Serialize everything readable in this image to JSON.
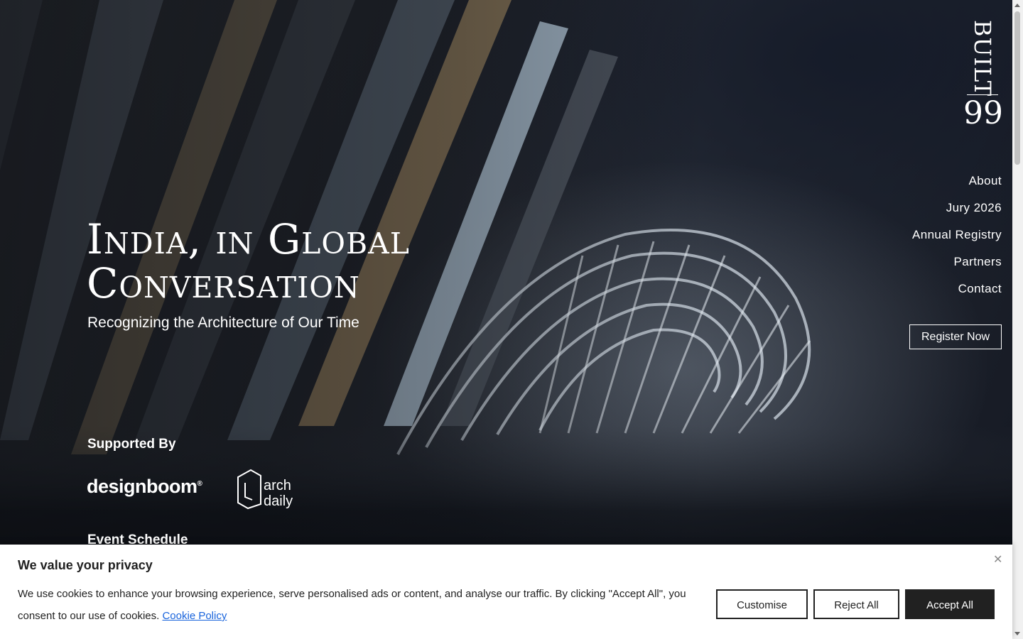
{
  "logo": {
    "word": "BUILT",
    "number": "99"
  },
  "nav": {
    "items": [
      {
        "label": "About"
      },
      {
        "label": "Jury 2026"
      },
      {
        "label": "Annual Registry"
      },
      {
        "label": "Partners"
      },
      {
        "label": "Contact"
      }
    ],
    "register_label": "Register Now"
  },
  "hero": {
    "headline_line1": "India, in Global",
    "headline_line2": "Conversation",
    "subhead": "Recognizing the Architecture of Our Time"
  },
  "supported": {
    "heading": "Supported By",
    "partners": [
      {
        "name": "designboom",
        "mark": "®"
      },
      {
        "line1": "arch",
        "line2": "daily"
      }
    ]
  },
  "schedule": {
    "heading": "Event Schedule"
  },
  "cookie": {
    "title": "We value your privacy",
    "body": "We use cookies to enhance your browsing experience, serve personalised ads or content, and analyse our traffic. By clicking \"Accept All\", you consent to our use of cookies.",
    "link_label": "Cookie Policy",
    "close_icon": "close-icon",
    "buttons": {
      "customise": "Customise",
      "reject": "Reject All",
      "accept": "Accept All"
    }
  },
  "colors": {
    "accent": "#212121",
    "link": "#1863dc"
  }
}
